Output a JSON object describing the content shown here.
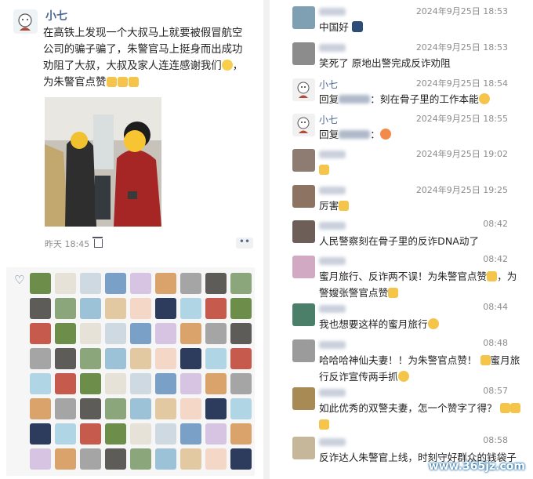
{
  "post": {
    "name": "小七",
    "text": "在高铁上发现一个大叔马上就要被假冒航空公司的骗子骗了，朱警官马上挺身而出成功劝阻了大叔，大叔及家人连连感谢我们",
    "text_end": "，为朱警官点赞",
    "time": "昨天 18:45",
    "more": "••"
  },
  "comments": [
    {
      "name": "",
      "time": "2024年9月25日 18:53",
      "text": "中国好"
    },
    {
      "name": "",
      "time": "2024年9月25日 18:53",
      "text": "笑死了 原地出警完成反诈劝阻"
    },
    {
      "name": "小七",
      "time": "2024年9月25日 18:54",
      "text_prefix": "回复",
      "text": "：刻在骨子里的工作本能"
    },
    {
      "name": "小七",
      "time": "2024年9月25日 18:55",
      "text_prefix": "回复",
      "text": "："
    },
    {
      "name": "",
      "time": "2024年9月25日 19:02",
      "text": ""
    },
    {
      "name": "",
      "time": "2024年9月25日 19:25",
      "text": "厉害"
    },
    {
      "name": "",
      "time": "08:42",
      "text": "人民警察刻在骨子里的反诈DNA动了"
    },
    {
      "name": "",
      "time": "08:42",
      "text": "蜜月旅行、反诈两不误！为朱警官点赞",
      "text2": "，为警嫂张警官点赞"
    },
    {
      "name": "",
      "time": "08:44",
      "text": "我也想要这样的蜜月旅行"
    },
    {
      "name": "",
      "time": "08:48",
      "text": "哈哈哈神仙夫妻！！为朱警官点赞！",
      "text2": "蜜月旅行反诈宣传两手抓"
    },
    {
      "name": "",
      "time": "08:57",
      "text": "如此优秀的双警夫妻，怎一个赞字了得？"
    },
    {
      "name": "",
      "time": "08:58",
      "text": "反诈达人朱警官上线，时刻守好群众的钱袋子"
    }
  ],
  "watermark": "www.365jz.com",
  "colors": {
    "name": "#4f6a95",
    "time": "#8c8c8c",
    "panel": "#f6f6f6"
  }
}
